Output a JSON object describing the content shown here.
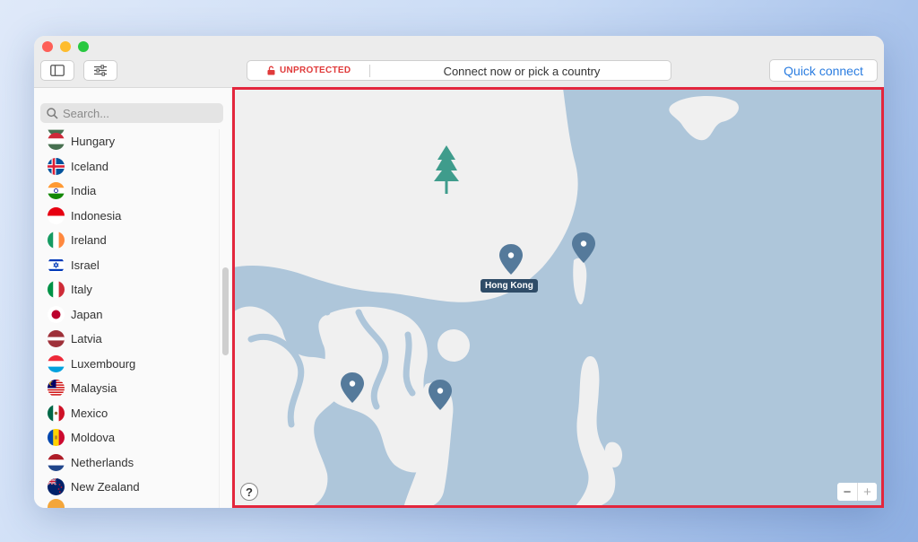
{
  "toolbar": {
    "status": "UNPROTECTED",
    "status_message": "Connect now or pick a country",
    "quick_connect_label": "Quick connect"
  },
  "search": {
    "placeholder": "Search..."
  },
  "countries": [
    {
      "name": "Hungary"
    },
    {
      "name": "Iceland"
    },
    {
      "name": "India"
    },
    {
      "name": "Indonesia"
    },
    {
      "name": "Ireland"
    },
    {
      "name": "Israel"
    },
    {
      "name": "Italy"
    },
    {
      "name": "Japan"
    },
    {
      "name": "Latvia"
    },
    {
      "name": "Luxembourg"
    },
    {
      "name": "Malaysia"
    },
    {
      "name": "Mexico"
    },
    {
      "name": "Moldova"
    },
    {
      "name": "Netherlands"
    },
    {
      "name": "New Zealand"
    }
  ],
  "map": {
    "location_label": "Hong Kong",
    "help_label": "?",
    "zoom_out_label": "−",
    "zoom_in_label": "+",
    "colors": {
      "water": "#aec6da",
      "land": "#f0f0f0",
      "pin": "#557a9b",
      "highlight": "#e3263d"
    }
  }
}
